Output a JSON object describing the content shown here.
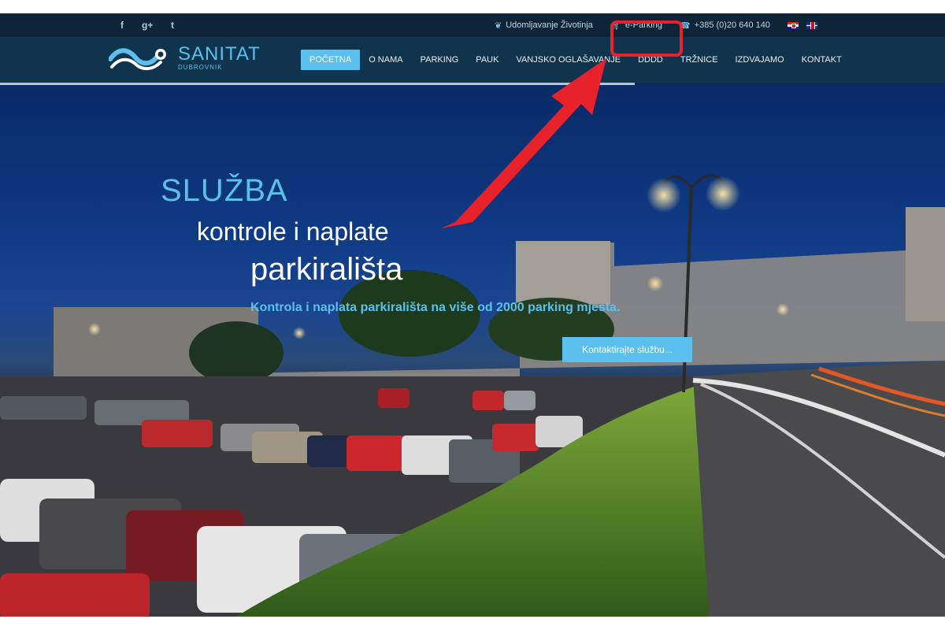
{
  "topbar": {
    "social": [
      {
        "icon": "facebook-icon",
        "glyph": "f"
      },
      {
        "icon": "google-plus-icon",
        "glyph": "g+"
      },
      {
        "icon": "twitter-icon",
        "glyph": "t"
      }
    ],
    "adoption_label": "Udomljavanje Životinja",
    "eparking_label": "e-Parking",
    "phone_label": "+385 (0)20 640 140",
    "languages": [
      "hr",
      "en"
    ]
  },
  "logo": {
    "name": "SANITAT",
    "sub": "DUBROVNIK"
  },
  "menu": [
    {
      "label": "POČETNA",
      "active": true
    },
    {
      "label": "O NAMA",
      "active": false
    },
    {
      "label": "PARKING",
      "active": false
    },
    {
      "label": "PAUK",
      "active": false
    },
    {
      "label": "VANJSKO OGLAŠAVANJE",
      "active": false
    },
    {
      "label": "DDDD",
      "active": false
    },
    {
      "label": "TRŽNICE",
      "active": false
    },
    {
      "label": "IZDVAJAMO",
      "active": false
    },
    {
      "label": "KONTAKT",
      "active": false
    }
  ],
  "hero": {
    "title": "SLUŽBA",
    "line2": "kontrole i naplate",
    "line3": "parkirališta",
    "subtitle": "Kontrola i naplata parkirališta na više od 2000 parking mjesta.",
    "cta_label": "Kontaktirajte službu..."
  },
  "colors": {
    "accent": "#5bc0ee",
    "topbar": "#0d2536",
    "navbar": "#10344e",
    "annotation": "#e8222b"
  }
}
